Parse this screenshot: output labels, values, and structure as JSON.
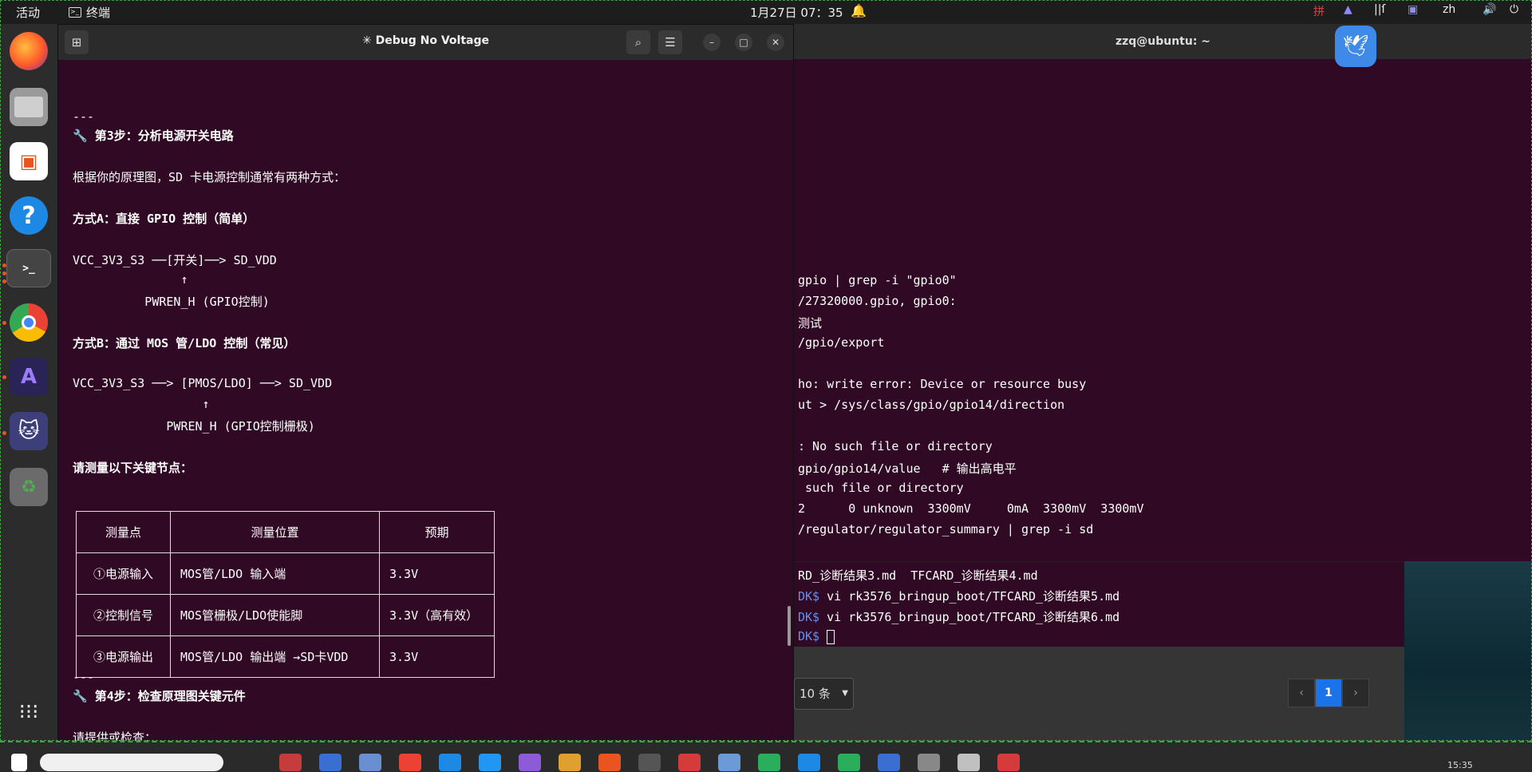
{
  "topbar": {
    "activities": "活动",
    "app": "终端",
    "clock": "1月27日  07：35",
    "lang": "zh"
  },
  "main": {
    "title": "✳ Debug No Voltage",
    "lines": {
      "sep1": "---",
      "step3": "🔧 第3步：分析电源开关电路",
      "intro": "根据你的原理图，SD 卡电源控制通常有两种方式：",
      "methodA": "方式A：直接 GPIO 控制（简单）",
      "a1": "VCC_3V3_S3 ──[开关]──> SD_VDD",
      "a2": "               ↑",
      "a3": "          PWREN_H (GPIO控制)",
      "methodB": "方式B：通过 MOS 管/LDO 控制（常见）",
      "b1": "VCC_3V3_S3 ──> [PMOS/LDO] ──> SD_VDD",
      "b2": "                  ↑",
      "b3": "             PWREN_H (GPIO控制栅极)",
      "measure": "请测量以下关键节点：",
      "sep2": "---",
      "step4": "🔧 第4步：检查原理图关键元件",
      "provide": "请提供或检查："
    },
    "table": {
      "headers": [
        "测量点",
        "测量位置",
        "预期"
      ],
      "rows": [
        [
          "①电源输入",
          "MOS管/LDO 输入端",
          "3.3V"
        ],
        [
          "②控制信号",
          "MOS管栅极/LDO使能脚",
          "3.3V（高有效）"
        ],
        [
          "③电源输出",
          "MOS管/LDO 输出端 →SD卡VDD",
          "3.3V"
        ]
      ]
    }
  },
  "bgterm": {
    "title": "zzq@ubuntu: ~",
    "lines": [
      "gpio | grep -i \"gpio0\"",
      "/27320000.gpio, gpio0:",
      "测试",
      "/gpio/export",
      "",
      "ho: write error: Device or resource busy",
      "ut > /sys/class/gpio/gpio14/direction",
      "",
      ": No such file or directory",
      "gpio/gpio14/value   # 输出高电平",
      " such file or directory",
      "2      0 unknown  3300mV     0mA  3300mV  3300mV",
      "/regulator/regulator_summary | grep -i sd"
    ]
  },
  "bgterm2": {
    "lines": [
      "RD_诊断结果3.md  TFCARD_诊断结果4.md",
      "vi rk3576_bringup_boot/TFCARD_诊断结果5.md",
      "vi rk3576_bringup_boot/TFCARD_诊断结果6.md",
      ""
    ],
    "prompt": "DK$"
  },
  "web": {
    "pagesize": "10 条",
    "page": "1",
    "prev": "‹",
    "next": "›"
  },
  "taskbar": {
    "time": "15:35"
  }
}
